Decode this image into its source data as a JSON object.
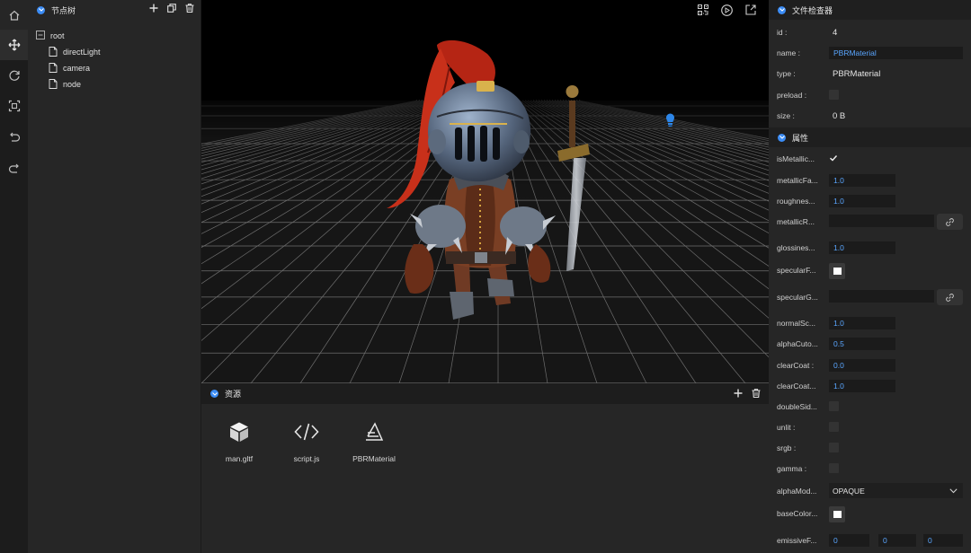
{
  "toolbar": {
    "tools": [
      {
        "name": "home-icon"
      },
      {
        "name": "move-icon"
      },
      {
        "name": "rotate-icon"
      },
      {
        "name": "scale-icon"
      },
      {
        "name": "undo-icon"
      },
      {
        "name": "redo-icon"
      }
    ]
  },
  "node_tree": {
    "title": "节点树",
    "items": [
      {
        "label": "root"
      },
      {
        "label": "directLight"
      },
      {
        "label": "camera"
      },
      {
        "label": "node"
      }
    ]
  },
  "resources": {
    "title": "资源",
    "assets": [
      {
        "label": "man.gltf",
        "icon": "cube-icon"
      },
      {
        "label": "script.js",
        "icon": "code-icon"
      },
      {
        "label": "PBRMaterial",
        "icon": "material-icon"
      }
    ]
  },
  "inspector": {
    "title": "文件检查器",
    "file": {
      "id_label": "id :",
      "id_value": "4",
      "name_label": "name :",
      "name_value": "PBRMaterial",
      "type_label": "type :",
      "type_value": "PBRMaterial",
      "preload_label": "preload :",
      "size_label": "size :",
      "size_value": "0 B"
    },
    "props_title": "属性",
    "props": {
      "isMetallic_label": "isMetallic...",
      "metallicFactor_label": "metallicFa...",
      "metallicFactor_value": "1.0",
      "roughness_label": "roughnes...",
      "roughness_value": "1.0",
      "metallicRoughness_label": "metallicR...",
      "glossiness_label": "glossines...",
      "glossiness_value": "1.0",
      "specularFactor_label": "specularF...",
      "specularGlossiness_label": "specularG...",
      "normalScale_label": "normalSc...",
      "normalScale_value": "1.0",
      "alphaCutoff_label": "alphaCuto...",
      "alphaCutoff_value": "0.5",
      "clearCoat_label": "clearCoat :",
      "clearCoat_value": "0.0",
      "clearCoatRoughness_label": "clearCoat...",
      "clearCoatRoughness_value": "1.0",
      "doubleSided_label": "doubleSid...",
      "unlit_label": "unlit :",
      "srgb_label": "srgb :",
      "gamma_label": "gamma :",
      "alphaMode_label": "alphaMod...",
      "alphaMode_value": "OPAQUE",
      "baseColor_label": "baseColor...",
      "emissive_label": "emissiveF...",
      "emissive_r": "0",
      "emissive_g": "0",
      "emissive_b": "0"
    }
  }
}
